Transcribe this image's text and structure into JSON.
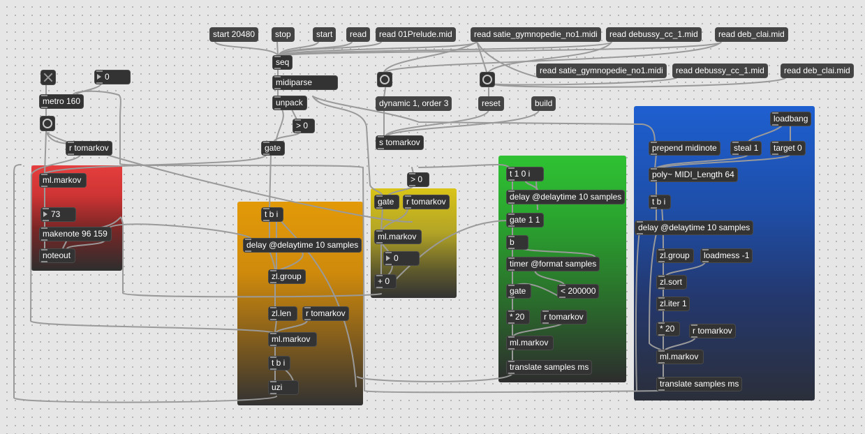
{
  "messages": {
    "start_20480": "start 20480",
    "stop": "stop",
    "start": "start",
    "read": "read",
    "read_prelude": "read 01Prelude.mid",
    "read_satie_1": "read satie_gymnopedie_no1.midi",
    "read_debussy_1": "read debussy_cc_1.mid",
    "read_deb_clai_1": "read deb_clai.mid",
    "read_satie_2": "read satie_gymnopedie_no1.midi",
    "read_debussy_2": "read debussy_cc_1.mid",
    "read_deb_clai_2": "read deb_clai.mid",
    "dynamic": "dynamic 1, order 3",
    "reset": "reset",
    "build": "build"
  },
  "top": {
    "seq": "seq",
    "midiparse": "midiparse",
    "unpack": "unpack",
    "gt0": "> 0",
    "gate": "gate",
    "s_tomarkov": "s tomarkov",
    "metro": "metro 160",
    "number_top": "0",
    "r_tomarkov": "r tomarkov"
  },
  "red": {
    "markov": "ml.markov",
    "number": "73",
    "makenote": "makenote 96 159",
    "noteout": "noteout"
  },
  "orange": {
    "tbi": "t b i",
    "delay": "delay @delaytime 10 samples",
    "zlgroup": "zl.group",
    "zllen": "zl.len",
    "r_tomarkov": "r tomarkov",
    "markov": "ml.markov",
    "tbi2": "t b i",
    "uzi": "uzi"
  },
  "yellow": {
    "gt0": "> 0",
    "gate": "gate",
    "r_tomarkov": "r tomarkov",
    "markov": "ml.markov",
    "number": "0",
    "plus0": "+ 0"
  },
  "green": {
    "t10i": "t 1 0 i",
    "delay": "delay @delaytime 10 samples",
    "gate11": "gate 1 1",
    "b": "b",
    "timer": "timer @format samples",
    "gate": "gate",
    "lt200000": "< 200000",
    "mul20": "* 20",
    "r_tomarkov": "r tomarkov",
    "markov": "ml.markov",
    "translate": "translate samples ms"
  },
  "blue": {
    "loadbang": "loadbang",
    "prepend": "prepend midinote",
    "steal": "steal 1",
    "target": "target 0",
    "poly": "poly~ MIDI_Length 64",
    "tbi": "t b i",
    "delay": "delay @delaytime 10 samples",
    "zlgroup": "zl.group",
    "loadmess": "loadmess -1",
    "zlsort": "zl.sort",
    "zliter": "zl.iter 1",
    "mul20": "* 20",
    "r_tomarkov": "r tomarkov",
    "markov": "ml.markov",
    "translate": "translate samples ms"
  },
  "colors": {
    "background": "#e6e6e6",
    "object": "#333333",
    "red_panel": "#e53e3e",
    "orange_panel": "#e39a08",
    "yellow_panel": "#d9c417",
    "green_panel": "#2fc233",
    "blue_panel": "#1e5fd0"
  }
}
